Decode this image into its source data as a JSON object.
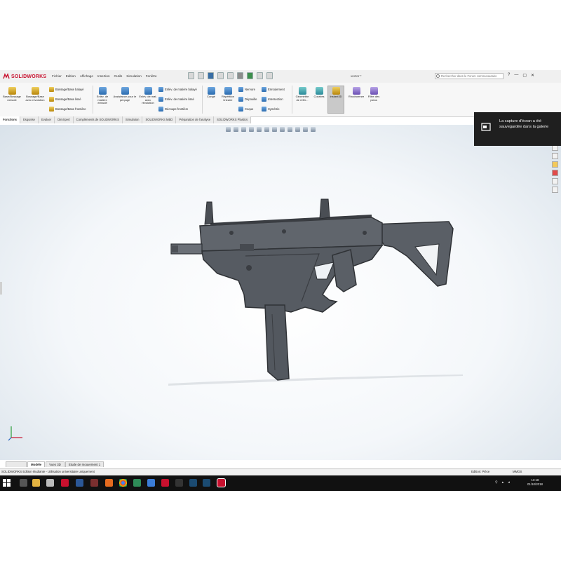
{
  "app": {
    "name": "SOLIDWORKS",
    "document_title": "vector *"
  },
  "menu": [
    "Fichier",
    "Edition",
    "Affichage",
    "Insertion",
    "Outils",
    "Simulation",
    "Fenêtre"
  ],
  "search": {
    "placeholder": "Rechercher dans le Forum communautaire"
  },
  "window_controls": [
    "?",
    "—",
    "▢",
    "✕"
  ],
  "ribbon": {
    "features": [
      {
        "label": "Base/Bossage extrudé"
      },
      {
        "label": "Bossage/Base avec révolution"
      }
    ],
    "boss_rows": [
      "Bossage/Base balayé",
      "Bossage/Base lissé",
      "Bossage/Base frontière"
    ],
    "cut": [
      {
        "label": "Enlèv. de matière extrudé"
      },
      {
        "label": "Assistance pour le perçage"
      },
      {
        "label": "Enlèv. de mat. avec révolution"
      }
    ],
    "cut_rows": [
      "Enlèv. de matière balayé",
      "Enlèv. de matière lissé",
      "Découpe frontière"
    ],
    "misc": [
      {
        "label": "Congé"
      },
      {
        "label": "Répétition linéaire"
      }
    ],
    "misc_rows": [
      "Nervure",
      "Dépouille",
      "Coque"
    ],
    "misc_rows2": [
      "Enroulement",
      "Intersection",
      "Symétrie"
    ],
    "extra": [
      {
        "label": "Géométrie de référ..."
      },
      {
        "label": "Courbes"
      },
      {
        "label": "Instant3D"
      },
      {
        "label": "Rhodromner"
      },
      {
        "label": "Filtre des plans"
      }
    ]
  },
  "tabs": [
    "Fonctions",
    "Esquisse",
    "Evaluer",
    "DimXpert",
    "Compléments de SOLIDWORKS",
    "Simulation",
    "SOLIDWORKS MBD",
    "Préparation de l'analyse",
    "SOLIDWORKS Plastics"
  ],
  "active_tab": "Fonctions",
  "notification": {
    "text": "La capture d'écran a été sauvegardée dans la galerie"
  },
  "bottom_tabs": [
    "",
    "Modèle",
    "Vues 3D",
    "Etude de mouvement 1"
  ],
  "status": {
    "left": "SOLIDWORKS Edition étudiante - Utilisation universitaire uniquement",
    "edit_mode": "Edition: Pièce",
    "units": "MMGS"
  },
  "clock": {
    "time": "13:18",
    "date": "01/10/2018"
  },
  "colors": {
    "brand": "#c8102e",
    "model": "#5a5f66",
    "viewport": "#eef2f6"
  }
}
